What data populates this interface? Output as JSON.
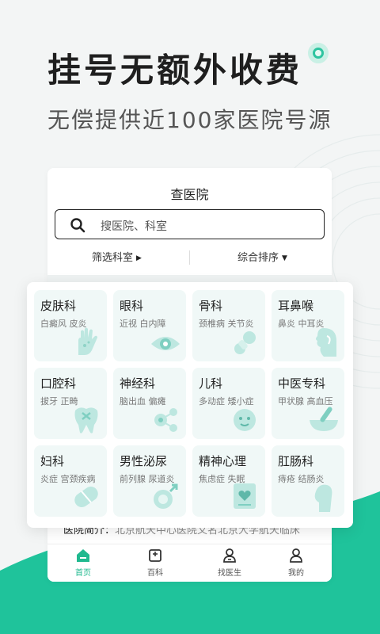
{
  "headline": "挂号无额外收费",
  "subline": "无偿提供近100家医院号源",
  "app": {
    "title": "查医院",
    "search_placeholder": "搜医院、科室",
    "filters": {
      "left": "筛选科室",
      "right": "综合排序"
    },
    "intro": {
      "label": "医院简介：",
      "text": "北京航天中心医院又名北京大学航天临床"
    },
    "tabs": [
      {
        "label": "首页",
        "icon": "home-icon",
        "active": true
      },
      {
        "label": "百科",
        "icon": "book-icon",
        "active": false
      },
      {
        "label": "找医生",
        "icon": "doctor-icon",
        "active": false
      },
      {
        "label": "我的",
        "icon": "user-icon",
        "active": false
      }
    ]
  },
  "departments": [
    {
      "name": "皮肤科",
      "tags": "白癜风  皮炎",
      "icon": "hand-icon"
    },
    {
      "name": "眼科",
      "tags": "近视  白内障",
      "icon": "eye-icon"
    },
    {
      "name": "骨科",
      "tags": "颈椎病  关节炎",
      "icon": "bone-icon"
    },
    {
      "name": "耳鼻喉",
      "tags": "鼻炎  中耳炎",
      "icon": "ear-icon"
    },
    {
      "name": "口腔科",
      "tags": "拔牙  正畸",
      "icon": "tooth-icon"
    },
    {
      "name": "神经科",
      "tags": "脑出血  偏瘫",
      "icon": "neuron-icon"
    },
    {
      "name": "儿科",
      "tags": "多动症  矮小症",
      "icon": "baby-icon"
    },
    {
      "name": "中医专科",
      "tags": "甲状腺  高血压",
      "icon": "mortar-icon"
    },
    {
      "name": "妇科",
      "tags": "炎症  宫颈疾病",
      "icon": "pill-icon"
    },
    {
      "name": "男性泌尿",
      "tags": "前列腺  尿道炎",
      "icon": "male-icon"
    },
    {
      "name": "精神心理",
      "tags": "焦虑症  失眠",
      "icon": "heart-book-icon"
    },
    {
      "name": "肛肠科",
      "tags": "痔疮  结肠炎",
      "icon": "head-profile-icon"
    }
  ],
  "colors": {
    "accent": "#20b98f",
    "cell_bg": "#f0f8f7",
    "illustration": "#bde7e0"
  }
}
